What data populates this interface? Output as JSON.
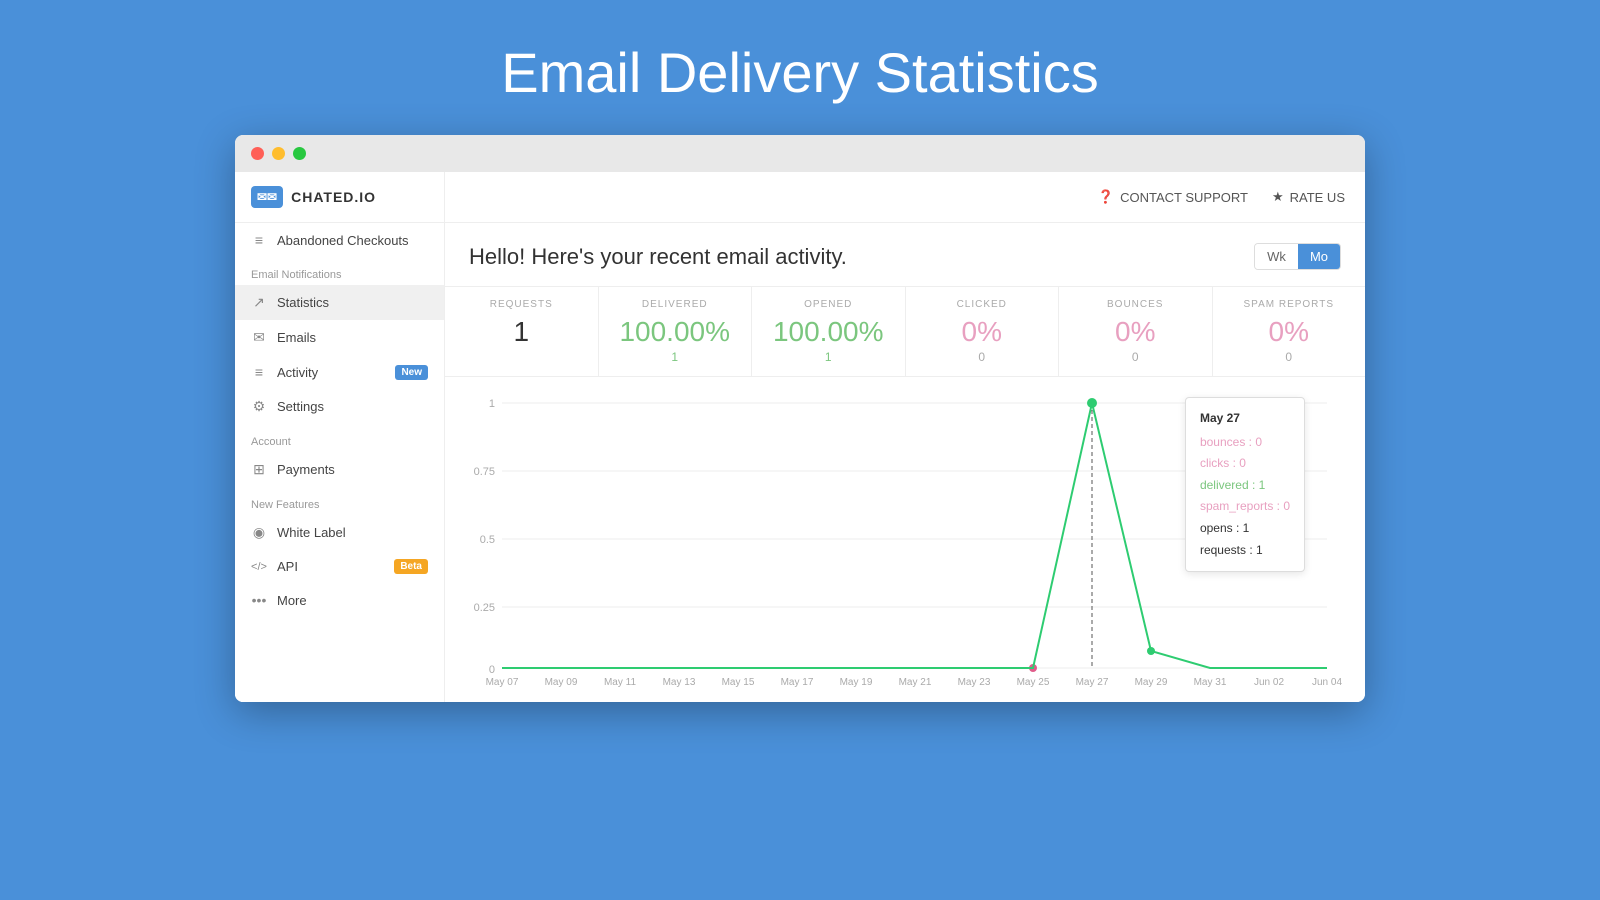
{
  "page": {
    "title": "Email Delivery Statistics"
  },
  "header": {
    "brand": "CHATED.IO",
    "contact_support": "CONTACT SUPPORT",
    "rate_us": "RATE US"
  },
  "sidebar": {
    "sections": [
      {
        "label": null,
        "items": [
          {
            "id": "abandoned-checkouts",
            "icon": "≡",
            "label": "Abandoned Checkouts"
          }
        ]
      },
      {
        "label": "Email Notifications",
        "items": [
          {
            "id": "statistics",
            "icon": "↗",
            "label": "Statistics",
            "active": true
          },
          {
            "id": "emails",
            "icon": "✉",
            "label": "Emails"
          },
          {
            "id": "activity",
            "icon": "≡",
            "label": "Activity",
            "badge": "New"
          },
          {
            "id": "settings",
            "icon": "⚙",
            "label": "Settings"
          }
        ]
      },
      {
        "label": "Account",
        "items": [
          {
            "id": "payments",
            "icon": "⊞",
            "label": "Payments"
          }
        ]
      },
      {
        "label": "New Features",
        "items": [
          {
            "id": "white-label",
            "icon": "◉",
            "label": "White Label"
          },
          {
            "id": "api",
            "icon": "</>",
            "label": "API",
            "badge_beta": "Beta"
          },
          {
            "id": "more",
            "icon": "…",
            "label": "More"
          }
        ]
      }
    ]
  },
  "content": {
    "heading": "Hello! Here's your recent email activity.",
    "toggle": {
      "week_label": "Wk",
      "month_label": "Mo",
      "active": "Mo"
    },
    "stats": [
      {
        "id": "requests",
        "label": "REQUESTS",
        "value": "1",
        "sub": "",
        "color": "normal"
      },
      {
        "id": "delivered",
        "label": "DELIVERED",
        "value": "100.00%",
        "sub": "1",
        "color": "green"
      },
      {
        "id": "opened",
        "label": "OPENED",
        "value": "100.00%",
        "sub": "1",
        "color": "green"
      },
      {
        "id": "clicked",
        "label": "CLICKED",
        "value": "0%",
        "sub": "0",
        "color": "pink"
      },
      {
        "id": "bounces",
        "label": "BOUNCES",
        "value": "0%",
        "sub": "0",
        "color": "pink"
      },
      {
        "id": "spam-reports",
        "label": "SPAM REPORTS",
        "value": "0%",
        "sub": "0",
        "color": "pink"
      }
    ],
    "chart": {
      "x_labels": [
        "May 07",
        "May 09",
        "May 11",
        "May 13",
        "May 15",
        "May 17",
        "May 19",
        "May 21",
        "May 23",
        "May 25",
        "May 27",
        "May 29",
        "May 31",
        "Jun 02",
        "Jun 04"
      ],
      "y_labels": [
        "0",
        "0.25",
        "0.5",
        "0.75",
        "1"
      ],
      "spike_x_index": 10,
      "tooltip": {
        "date": "May 27",
        "bounces": "bounces : 0",
        "clicks": "clicks : 0",
        "delivered": "delivered : 1",
        "spam_reports": "spam_reports : 0",
        "opens": "opens : 1",
        "requests": "requests : 1"
      }
    }
  }
}
